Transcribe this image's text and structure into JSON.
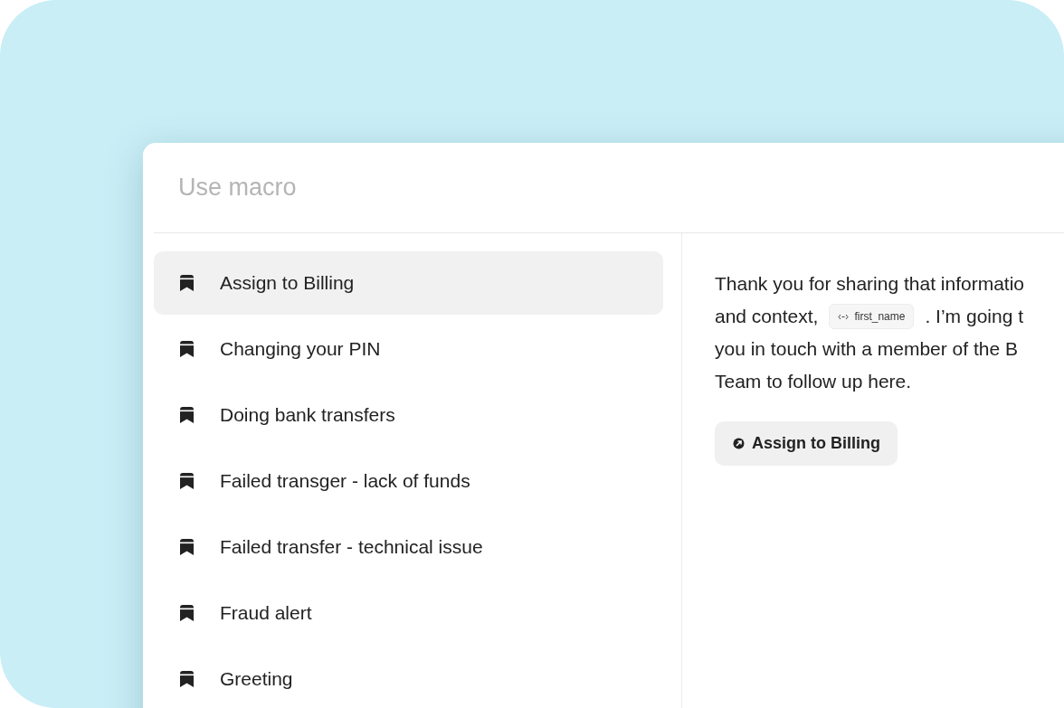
{
  "search": {
    "placeholder": "Use macro"
  },
  "macros": [
    {
      "label": "Assign to Billing",
      "selected": true
    },
    {
      "label": "Changing your PIN",
      "selected": false
    },
    {
      "label": "Doing bank transfers",
      "selected": false
    },
    {
      "label": "Failed transger - lack of funds",
      "selected": false
    },
    {
      "label": "Failed transfer - technical issue",
      "selected": false
    },
    {
      "label": "Fraud alert",
      "selected": false
    },
    {
      "label": "Greeting",
      "selected": false
    }
  ],
  "preview": {
    "lines": [
      [
        {
          "kind": "text",
          "text": "Thank you for sharing that informatio"
        }
      ],
      [
        {
          "kind": "text",
          "text": "and context,"
        },
        {
          "kind": "variable",
          "text": "first_name"
        },
        {
          "kind": "text",
          "text": ". I’m going t"
        }
      ],
      [
        {
          "kind": "text",
          "text": "you in touch with a member of the B"
        }
      ],
      [
        {
          "kind": "text",
          "text": "Team to follow up here."
        }
      ]
    ],
    "action": {
      "label": "Assign to Billing"
    }
  }
}
